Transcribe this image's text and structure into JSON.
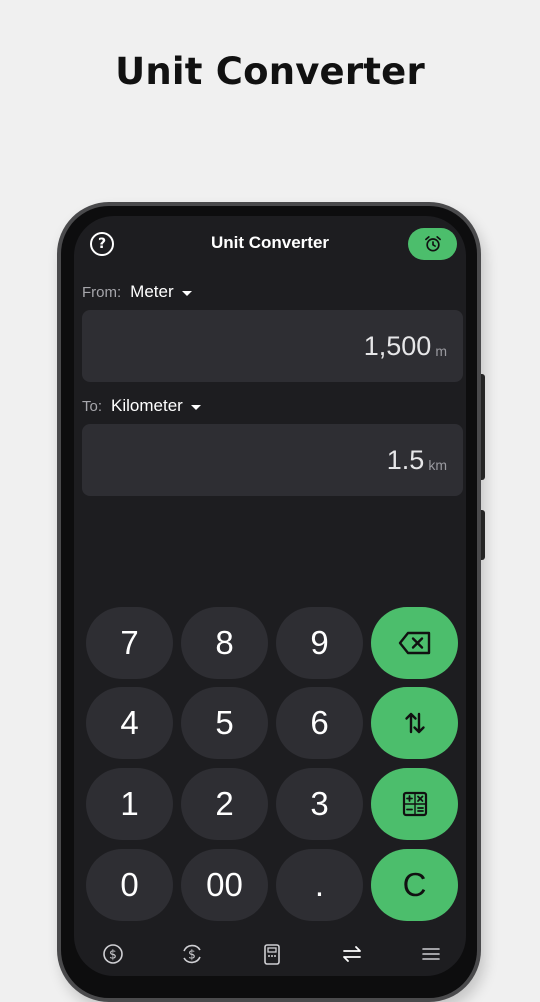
{
  "promo": {
    "title": "Unit Converter"
  },
  "header": {
    "title": "Unit Converter",
    "help_icon": "help-circle-icon",
    "alarm_icon": "alarm-clock-icon",
    "accent_color": "#4cbe6c"
  },
  "from": {
    "prefix": "From:",
    "unit": "Meter",
    "value": "1,500",
    "symbol": "m"
  },
  "to": {
    "prefix": "To:",
    "unit": "Kilometer",
    "value": "1.5",
    "symbol": "km"
  },
  "keypad": {
    "k7": "7",
    "k8": "8",
    "k9": "9",
    "k4": "4",
    "k5": "5",
    "k6": "6",
    "k1": "1",
    "k2": "2",
    "k3": "3",
    "k0": "0",
    "k00": "00",
    "kdot": ".",
    "clear": "C",
    "backspace_icon": "backspace-icon",
    "swap_icon": "swap-vertical-icon",
    "calculator_icon": "calculator-icon"
  },
  "bottom_nav": {
    "items": [
      "currency-icon",
      "currency-exchange-icon",
      "calculator-icon",
      "unit-converter-icon",
      "menu-icon"
    ]
  }
}
